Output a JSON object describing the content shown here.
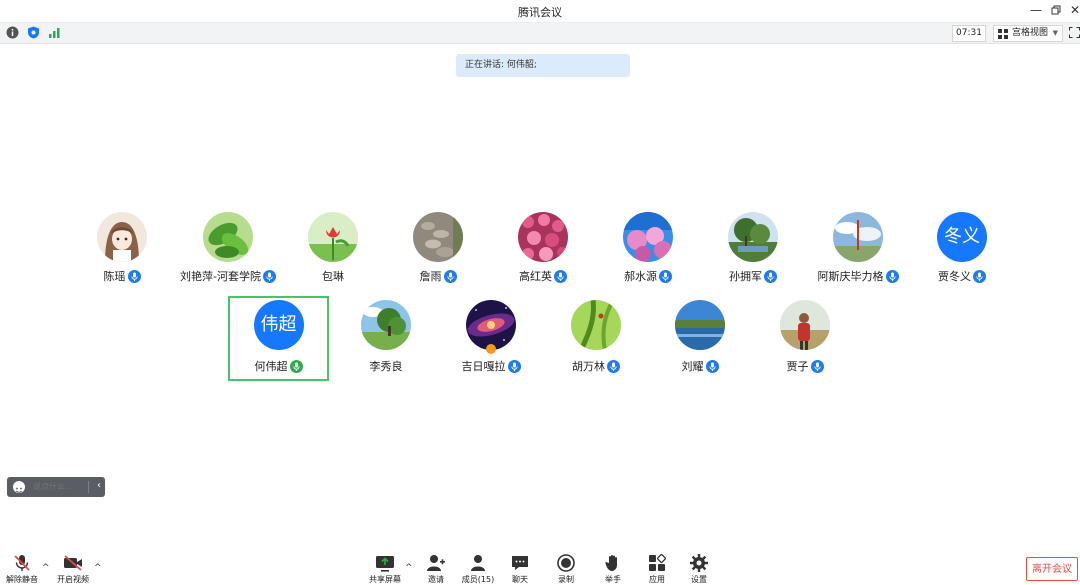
{
  "window": {
    "title": "腾讯会议"
  },
  "infobar": {
    "time": "07:31",
    "view_label": "宫格视图"
  },
  "speaking": {
    "text": "正在讲话: 何伟韶;"
  },
  "participants_row1": [
    {
      "name": "陈瑶",
      "avatar": "anime-girl"
    },
    {
      "name": "刘艳萍-河套学院",
      "avatar": "green-leaves"
    },
    {
      "name": "包琳",
      "avatar": "red-tulip"
    },
    {
      "name": "詹雨",
      "avatar": "stone-path"
    },
    {
      "name": "高红英",
      "avatar": "pink-flowers"
    },
    {
      "name": "郝水源",
      "avatar": "blossom-sky"
    },
    {
      "name": "孙拥军",
      "avatar": "tree-lake"
    },
    {
      "name": "阿斯庆毕力格",
      "avatar": "cloud-tower"
    },
    {
      "name": "贾冬义",
      "avatar": "text",
      "avatar_text": "冬义"
    }
  ],
  "participants_row2": [
    {
      "name": "何伟超",
      "avatar": "text",
      "avatar_text": "伟超",
      "active": true
    },
    {
      "name": "李秀良",
      "avatar": "tree-field"
    },
    {
      "name": "吉日嘎拉",
      "avatar": "galaxy",
      "host": true
    },
    {
      "name": "胡万林",
      "avatar": "grass-blade"
    },
    {
      "name": "刘耀",
      "avatar": "lake-landscape"
    },
    {
      "name": "贾子",
      "avatar": "man-field"
    }
  ],
  "chat": {
    "placeholder": "说点什么..."
  },
  "toolbar": {
    "unmute": "解除静音",
    "start_video": "开启视频",
    "share_screen": "共享屏幕",
    "invite": "邀请",
    "members": "成员(15)",
    "chat": "聊天",
    "record": "录制",
    "raise_hand": "举手",
    "apps": "应用",
    "settings": "设置",
    "leave": "离开会议"
  },
  "colors": {
    "accent": "#1677ff",
    "speaking_bg": "#dcebfb",
    "active_border": "#43c56b",
    "leave": "#e84a4a"
  }
}
